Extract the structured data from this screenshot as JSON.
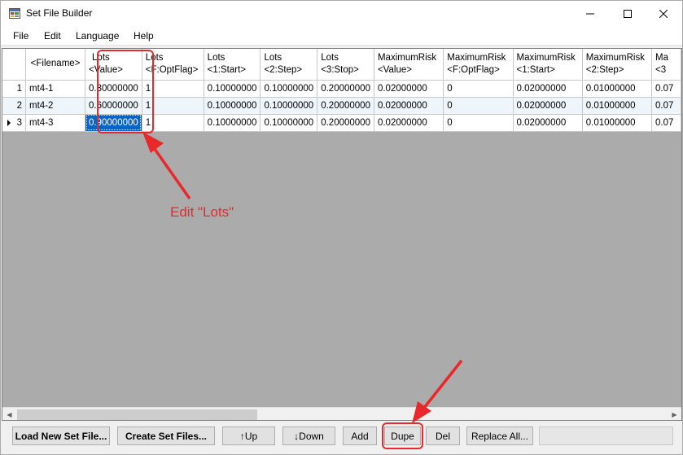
{
  "window": {
    "title": "Set File Builder"
  },
  "menu": [
    "File",
    "Edit",
    "Language",
    "Help"
  ],
  "grid": {
    "columns": [
      {
        "l1": "",
        "l2": ""
      },
      {
        "l1": "<Filename>",
        "l2": ""
      },
      {
        "l1": "Lots",
        "l2": "<Value>"
      },
      {
        "l1": "Lots",
        "l2": "<F:OptFlag>"
      },
      {
        "l1": "Lots",
        "l2": "<1:Start>"
      },
      {
        "l1": "Lots",
        "l2": "<2:Step>"
      },
      {
        "l1": "Lots",
        "l2": "<3:Stop>"
      },
      {
        "l1": "MaximumRisk",
        "l2": "<Value>"
      },
      {
        "l1": "MaximumRisk",
        "l2": "<F:OptFlag>"
      },
      {
        "l1": "MaximumRisk",
        "l2": "<1:Start>"
      },
      {
        "l1": "MaximumRisk",
        "l2": "<2:Step>"
      },
      {
        "l1": "Ma",
        "l2": "<3"
      }
    ],
    "rows": [
      [
        "1",
        "mt4-1",
        "0.30000000",
        "1",
        "0.10000000",
        "0.10000000",
        "0.20000000",
        "0.02000000",
        "0",
        "0.02000000",
        "0.01000000",
        "0.07"
      ],
      [
        "2",
        "mt4-2",
        "0.60000000",
        "1",
        "0.10000000",
        "0.10000000",
        "0.20000000",
        "0.02000000",
        "0",
        "0.02000000",
        "0.01000000",
        "0.07"
      ],
      [
        "3",
        "mt4-3",
        "0.90000000",
        "1",
        "0.10000000",
        "0.10000000",
        "0.20000000",
        "0.02000000",
        "0",
        "0.02000000",
        "0.01000000",
        "0.07"
      ]
    ],
    "selected_row": 2,
    "selected_col": 2
  },
  "annotation": {
    "text": "Edit \"Lots\""
  },
  "buttons": {
    "load": "Load New Set File...",
    "create": "Create Set Files...",
    "up": "↑Up",
    "down": "↓Down",
    "add": "Add",
    "dupe": "Dupe",
    "del": "Del",
    "replace": "Replace All..."
  },
  "colors": {
    "annotation": "#e8282a",
    "selection": "#0a64c8"
  }
}
